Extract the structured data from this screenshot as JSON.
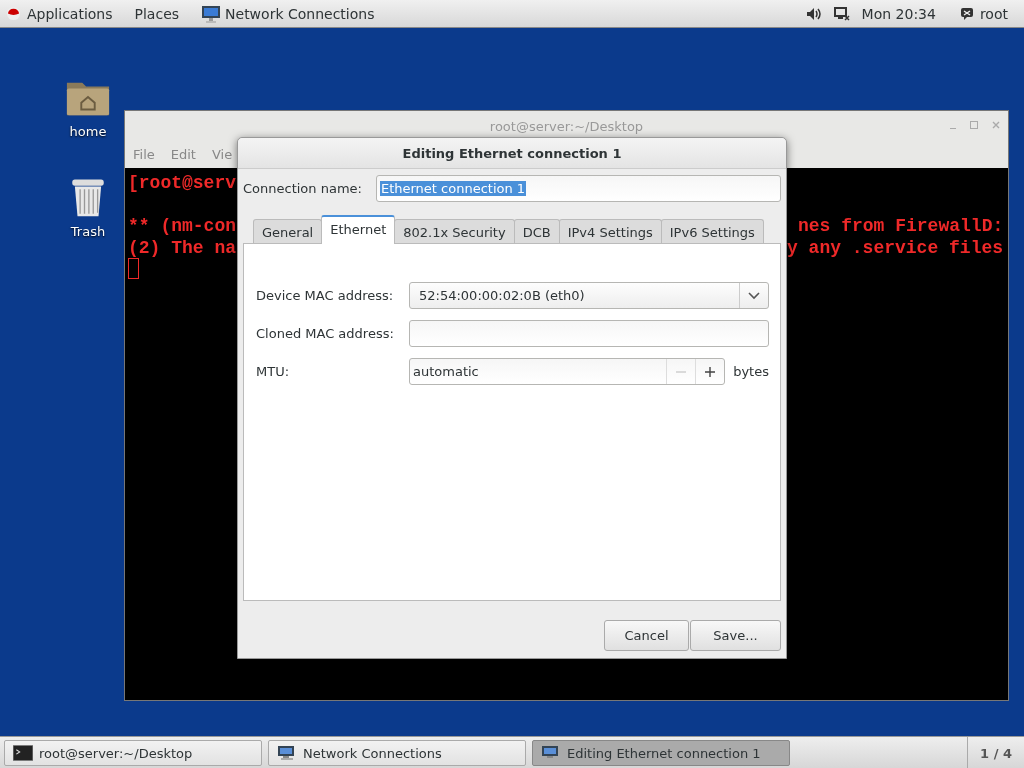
{
  "top_bar": {
    "menus": [
      "Applications",
      "Places"
    ],
    "app_name": "Network Connections",
    "clock": "Mon 20:34",
    "user": "root"
  },
  "desktop_icons": [
    {
      "kind": "folder",
      "label": "home"
    },
    {
      "kind": "trash",
      "label": "Trash"
    }
  ],
  "terminal": {
    "title": "root@server:~/Desktop",
    "menus": [
      "File",
      "Edit",
      "Vie"
    ],
    "lines": [
      {
        "left": "[root@serv"
      },
      {
        "left": "** (nm-con",
        "right": "nes from FirewallD:"
      },
      {
        "left": "(2) The na",
        "right": "y any .service files"
      }
    ]
  },
  "dialog": {
    "title": "Editing Ethernet connection 1",
    "name_label": "Connection name:",
    "name_value": "Ethernet connection 1",
    "name_selected": true,
    "tabs": [
      {
        "label": "General",
        "selected": false
      },
      {
        "label": "Ethernet",
        "selected": true
      },
      {
        "label": "802.1x Security",
        "selected": false
      },
      {
        "label": "DCB",
        "selected": false
      },
      {
        "label": "IPv4 Settings",
        "selected": false
      },
      {
        "label": "IPv6 Settings",
        "selected": false
      }
    ],
    "fields": [
      {
        "kind": "combo",
        "label": "Device MAC address:",
        "value": "52:54:00:00:02:0B (eth0)"
      },
      {
        "kind": "entry",
        "label": "Cloned MAC address:"
      },
      {
        "kind": "spin",
        "label": "MTU:",
        "value": "automatic",
        "unit": "bytes"
      }
    ],
    "buttons": [
      "Cancel",
      "Save..."
    ]
  },
  "taskbar": {
    "items": [
      {
        "kind": "terminal",
        "label": "root@server:~/Desktop",
        "selected": false
      },
      {
        "kind": "network",
        "label": "Network Connections",
        "selected": false
      },
      {
        "kind": "network",
        "label": "Editing Ethernet connection 1",
        "selected": true
      }
    ],
    "pager": "1 / 4"
  }
}
